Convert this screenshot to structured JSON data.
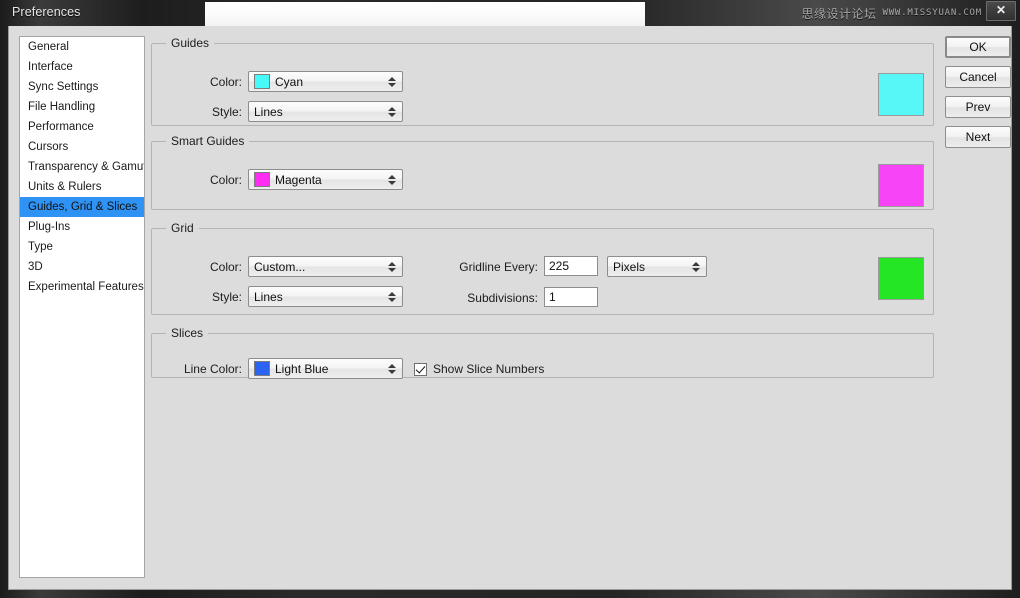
{
  "window": {
    "title": "Preferences",
    "close_label": "✕",
    "watermark_cn": "思缘设计论坛",
    "watermark_en": "WWW.MISSYUAN.COM"
  },
  "sidebar": {
    "items": [
      {
        "label": "General",
        "selected": false
      },
      {
        "label": "Interface",
        "selected": false
      },
      {
        "label": "Sync Settings",
        "selected": false
      },
      {
        "label": "File Handling",
        "selected": false
      },
      {
        "label": "Performance",
        "selected": false
      },
      {
        "label": "Cursors",
        "selected": false
      },
      {
        "label": "Transparency & Gamut",
        "selected": false
      },
      {
        "label": "Units & Rulers",
        "selected": false
      },
      {
        "label": "Guides, Grid & Slices",
        "selected": true
      },
      {
        "label": "Plug-Ins",
        "selected": false
      },
      {
        "label": "Type",
        "selected": false
      },
      {
        "label": "3D",
        "selected": false
      },
      {
        "label": "Experimental Features",
        "selected": false
      }
    ]
  },
  "guides": {
    "legend": "Guides",
    "color_label": "Color:",
    "color_value": "Cyan",
    "color_hex": "#47f9f9",
    "style_label": "Style:",
    "style_value": "Lines",
    "preview_hex": "#58f7f7"
  },
  "smart_guides": {
    "legend": "Smart Guides",
    "color_label": "Color:",
    "color_value": "Magenta",
    "color_hex": "#ff2df2",
    "preview_hex": "#f744f7"
  },
  "grid": {
    "legend": "Grid",
    "color_label": "Color:",
    "color_value": "Custom...",
    "style_label": "Style:",
    "style_value": "Lines",
    "gridline_label": "Gridline Every:",
    "gridline_value": "225",
    "units_value": "Pixels",
    "subdivisions_label": "Subdivisions:",
    "subdivisions_value": "1",
    "preview_hex": "#25e625"
  },
  "slices": {
    "legend": "Slices",
    "line_color_label": "Line Color:",
    "line_color_value": "Light Blue",
    "line_color_hex": "#2c63f0",
    "show_numbers_label": "Show Slice Numbers",
    "show_numbers_checked": true
  },
  "buttons": {
    "ok": "OK",
    "cancel": "Cancel",
    "prev": "Prev",
    "next": "Next"
  },
  "theme": {
    "accent_selected": "#2e93f5",
    "dialog_bg": "#dcdcdc"
  }
}
